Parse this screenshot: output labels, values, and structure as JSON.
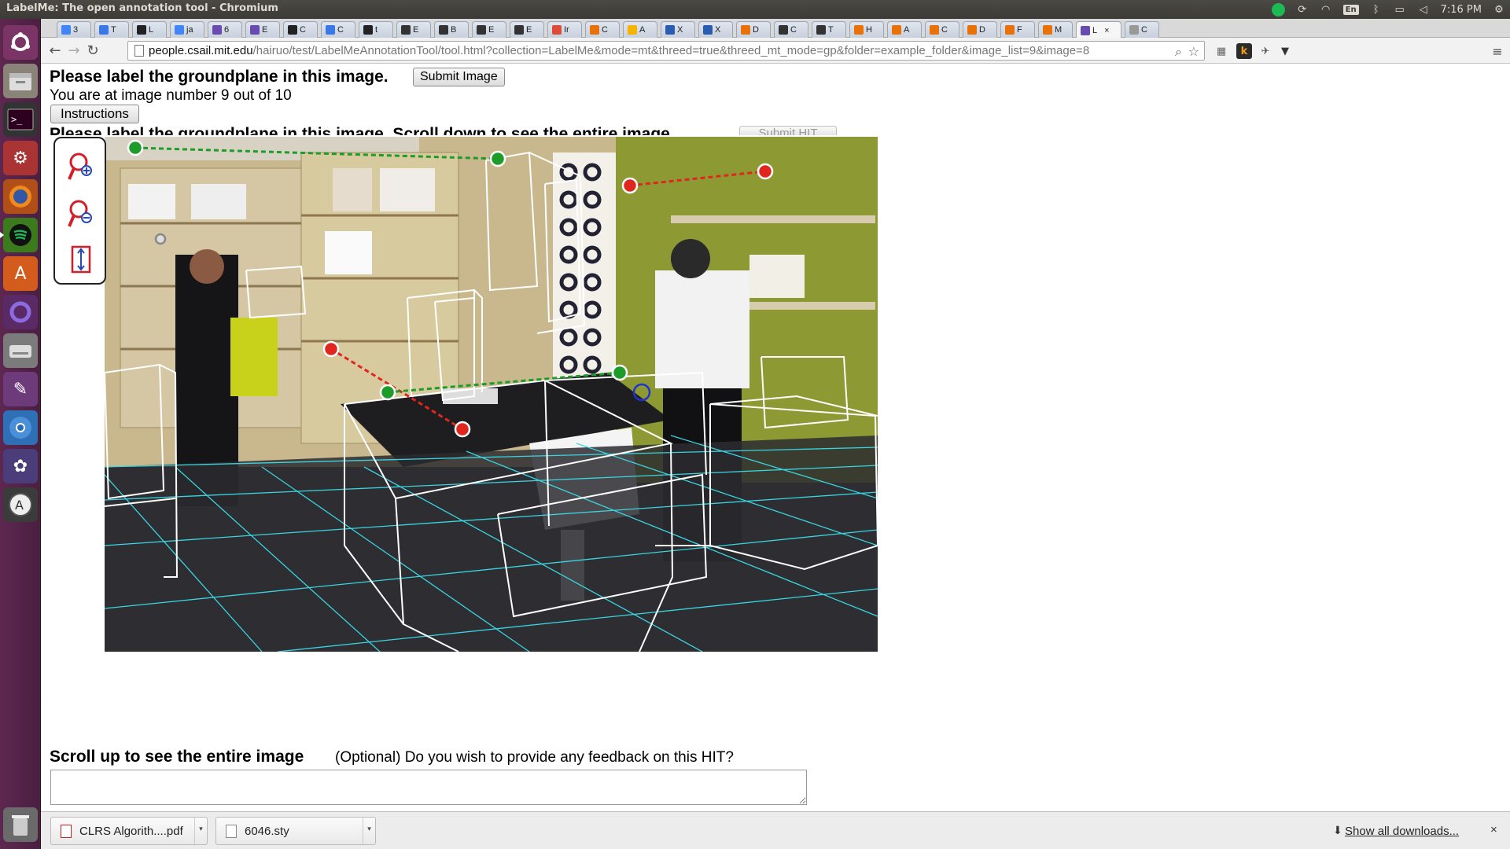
{
  "window": {
    "title": "LabelMe: The open annotation tool - Chromium"
  },
  "tray": {
    "keyboard": "En",
    "clock": "7:16 PM"
  },
  "tabs": [
    {
      "label": "3",
      "color": "#4285f4"
    },
    {
      "label": "T",
      "color": "#3b78e7"
    },
    {
      "label": "L",
      "color": "#222222"
    },
    {
      "label": "ja",
      "color": "#4285f4"
    },
    {
      "label": "6",
      "color": "#6a4bb0"
    },
    {
      "label": "E",
      "color": "#6a4bb0"
    },
    {
      "label": "C",
      "color": "#222222"
    },
    {
      "label": "C",
      "color": "#3b78e7"
    },
    {
      "label": "t",
      "color": "#222222"
    },
    {
      "label": "E",
      "color": "#333333"
    },
    {
      "label": "B",
      "color": "#333333"
    },
    {
      "label": "E",
      "color": "#333333"
    },
    {
      "label": "E",
      "color": "#333333"
    },
    {
      "label": "Ir",
      "color": "#dd4b39"
    },
    {
      "label": "C",
      "color": "#e8710a"
    },
    {
      "label": "A",
      "color": "#f4b400"
    },
    {
      "label": "X",
      "color": "#2a5db0"
    },
    {
      "label": "X",
      "color": "#2a5db0"
    },
    {
      "label": "D",
      "color": "#e8710a"
    },
    {
      "label": "C",
      "color": "#333333"
    },
    {
      "label": "T",
      "color": "#333333"
    },
    {
      "label": "H",
      "color": "#e8710a"
    },
    {
      "label": "A",
      "color": "#e8710a"
    },
    {
      "label": "C",
      "color": "#e8710a"
    },
    {
      "label": "D",
      "color": "#e8710a"
    },
    {
      "label": "F",
      "color": "#e8710a"
    },
    {
      "label": "M",
      "color": "#e8710a"
    },
    {
      "label": "L",
      "color": "#6a4bb0"
    },
    {
      "label": "C",
      "color": "#999999"
    }
  ],
  "address": {
    "host": "people.csail.mit.edu",
    "path": "/hairuo/test/LabelMeAnnotationTool/tool.html?collection=LabelMe&mode=mt&threed=true&threed_mt_mode=gp&folder=example_folder&image_list=9&image=8"
  },
  "page": {
    "heading1": "Please label the groundplane in this image.",
    "submit_image": "Submit Image",
    "progress_text": "You are at image number 9 out of 10",
    "instructions": "Instructions",
    "heading2": "Please label the groundplane in this image. Scroll down to see the entire image.",
    "submit_hit": "Submit HIT",
    "heading3": "Scroll up to see the entire image",
    "feedback_question": "(Optional) Do you wish to provide any feedback on this HIT?",
    "feedback_value": ""
  },
  "zoom_panel": {
    "buttons": [
      "zoom-in-icon",
      "zoom-out-icon",
      "fit-to-screen-icon"
    ]
  },
  "downloads": {
    "items": [
      {
        "filename": "CLRS Algorith....pdf"
      },
      {
        "filename": "6046.sty"
      }
    ],
    "show_all": "Show all downloads...",
    "close": "×"
  },
  "colors": {
    "launcher": "#5e2750",
    "groundplane_grid": "#39d5e0",
    "box_lines": "#ffffff",
    "point_green": "#1e9c2a",
    "point_red": "#e0261f",
    "point_blue": "#2233cc"
  }
}
